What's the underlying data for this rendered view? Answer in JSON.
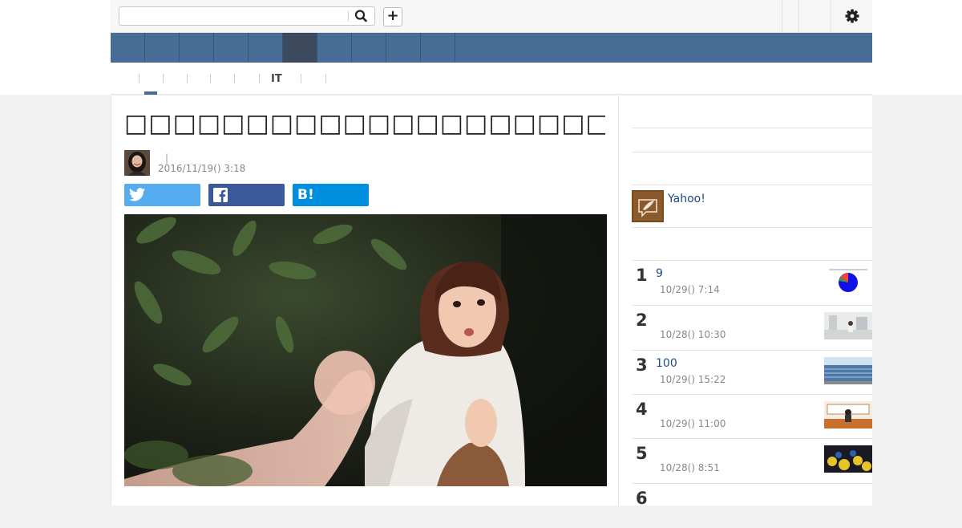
{
  "search": {
    "value": "",
    "placeholder": ""
  },
  "topbar": {
    "search_icon": "search-icon",
    "add_icon": "plus-icon",
    "add_label": "+",
    "settings_icon": "gear-icon"
  },
  "nav": {
    "items": [
      "",
      "",
      "",
      "",
      "",
      "",
      "",
      "",
      "",
      ""
    ],
    "active_index": 5
  },
  "subnav": {
    "items": [
      "",
      "",
      "",
      "",
      "",
      "IT",
      ""
    ],
    "active_index": 0
  },
  "article": {
    "title": "□□□□□□□□□□□□□□□□□□□□□□□□□□□□□□□□□□□□□□□",
    "author_separator": "|",
    "date": "2016/11/19() 3:18",
    "share": {
      "twitter_icon": "twitter-icon",
      "facebook_icon": "facebook-icon",
      "hatena_label": "B!"
    },
    "hero_image": "photo-woman-startled-hand-reaching"
  },
  "sidebar": {
    "promo": {
      "icon": "feather-quill-icon",
      "text": "Yahoo!"
    },
    "ranking": [
      {
        "rank": "1",
        "title": "9",
        "date": "10/29() 7:14",
        "thumb": "pie-chart-thumbnail"
      },
      {
        "rank": "2",
        "title": "",
        "date": "10/28() 10:30",
        "thumb": "hallway-thumbnail"
      },
      {
        "rank": "3",
        "title": "100",
        "date": "10/29() 15:22",
        "thumb": "building-thumbnail"
      },
      {
        "rank": "4",
        "title": "",
        "date": "10/29() 11:00",
        "thumb": "classroom-thumbnail"
      },
      {
        "rank": "5",
        "title": "",
        "date": "10/28() 8:51",
        "thumb": "crowd-thumbnail"
      },
      {
        "rank": "6",
        "title": "",
        "date": "",
        "thumb": ""
      }
    ]
  },
  "colors": {
    "nav": "#476c96",
    "nav_active": "#3d4a5e",
    "twitter": "#55acee",
    "facebook": "#3b5998",
    "hatena": "#008fde",
    "link": "#1a4a8a"
  }
}
